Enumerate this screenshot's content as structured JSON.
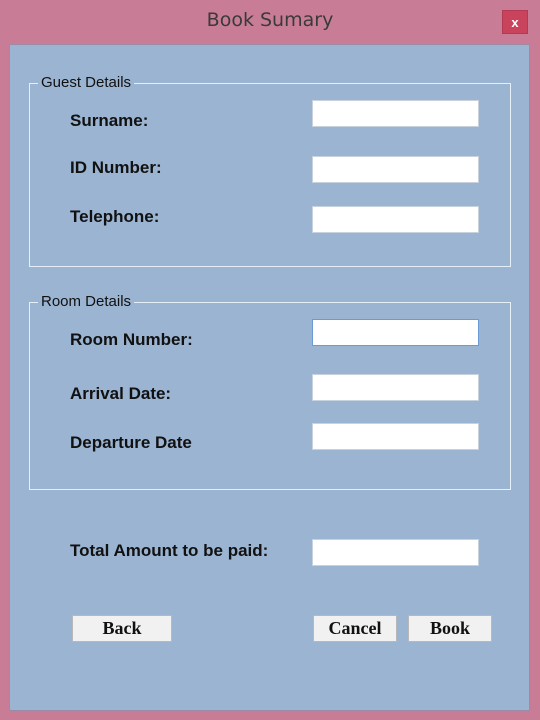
{
  "window": {
    "title": "Book Sumary",
    "close_glyph": "x"
  },
  "guest_details": {
    "legend": "Guest Details",
    "surname_label": "Surname:",
    "surname_value": "",
    "id_label": "ID Number:",
    "id_value": "",
    "telephone_label": "Telephone:",
    "telephone_value": ""
  },
  "room_details": {
    "legend": "Room Details",
    "room_number_label": "Room Number:",
    "room_number_value": "",
    "arrival_label": "Arrival Date:",
    "arrival_value": "",
    "departure_label": "Departure Date",
    "departure_value": ""
  },
  "total": {
    "label": "Total Amount to be paid:",
    "value": ""
  },
  "buttons": {
    "back": "Back",
    "cancel": "Cancel",
    "book": "Book"
  },
  "colors": {
    "frame": "#c97c96",
    "client": "#9ab4d2",
    "close": "#c9435c"
  }
}
